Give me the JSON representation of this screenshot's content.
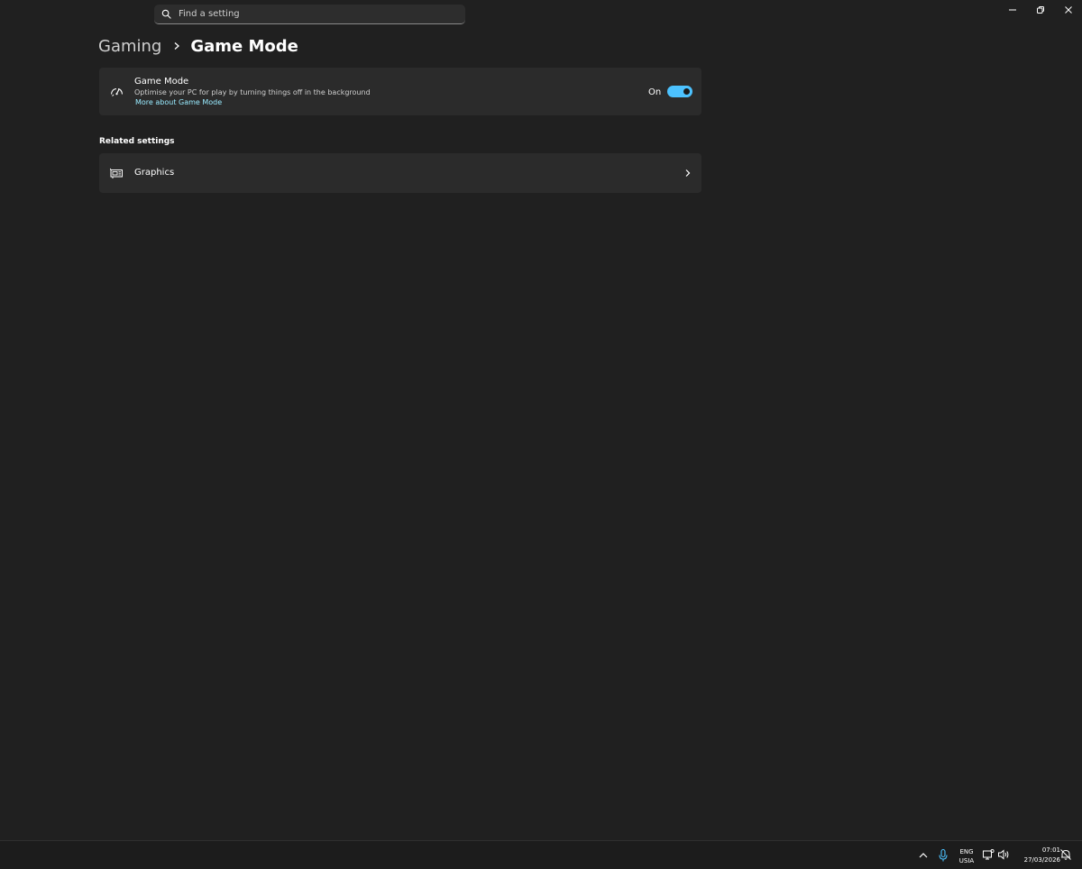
{
  "search": {
    "placeholder": "Find a setting"
  },
  "breadcrumb": {
    "parent": "Gaming",
    "current": "Game Mode"
  },
  "game_mode": {
    "title": "Game Mode",
    "description": "Optimise your PC for play by turning things off in the background",
    "link": "More about Game Mode",
    "toggle_state": "On",
    "toggle_on": true
  },
  "related": {
    "section_title": "Related settings",
    "items": [
      {
        "label": "Graphics"
      }
    ]
  },
  "taskbar": {
    "lang_line1": "ENG",
    "lang_line2": "USIA",
    "time": "07:01",
    "date": "27/03/2026"
  },
  "colors": {
    "background": "#202020",
    "card": "#2b2b2b",
    "accent": "#4cc2ff",
    "link": "#99ebff"
  }
}
